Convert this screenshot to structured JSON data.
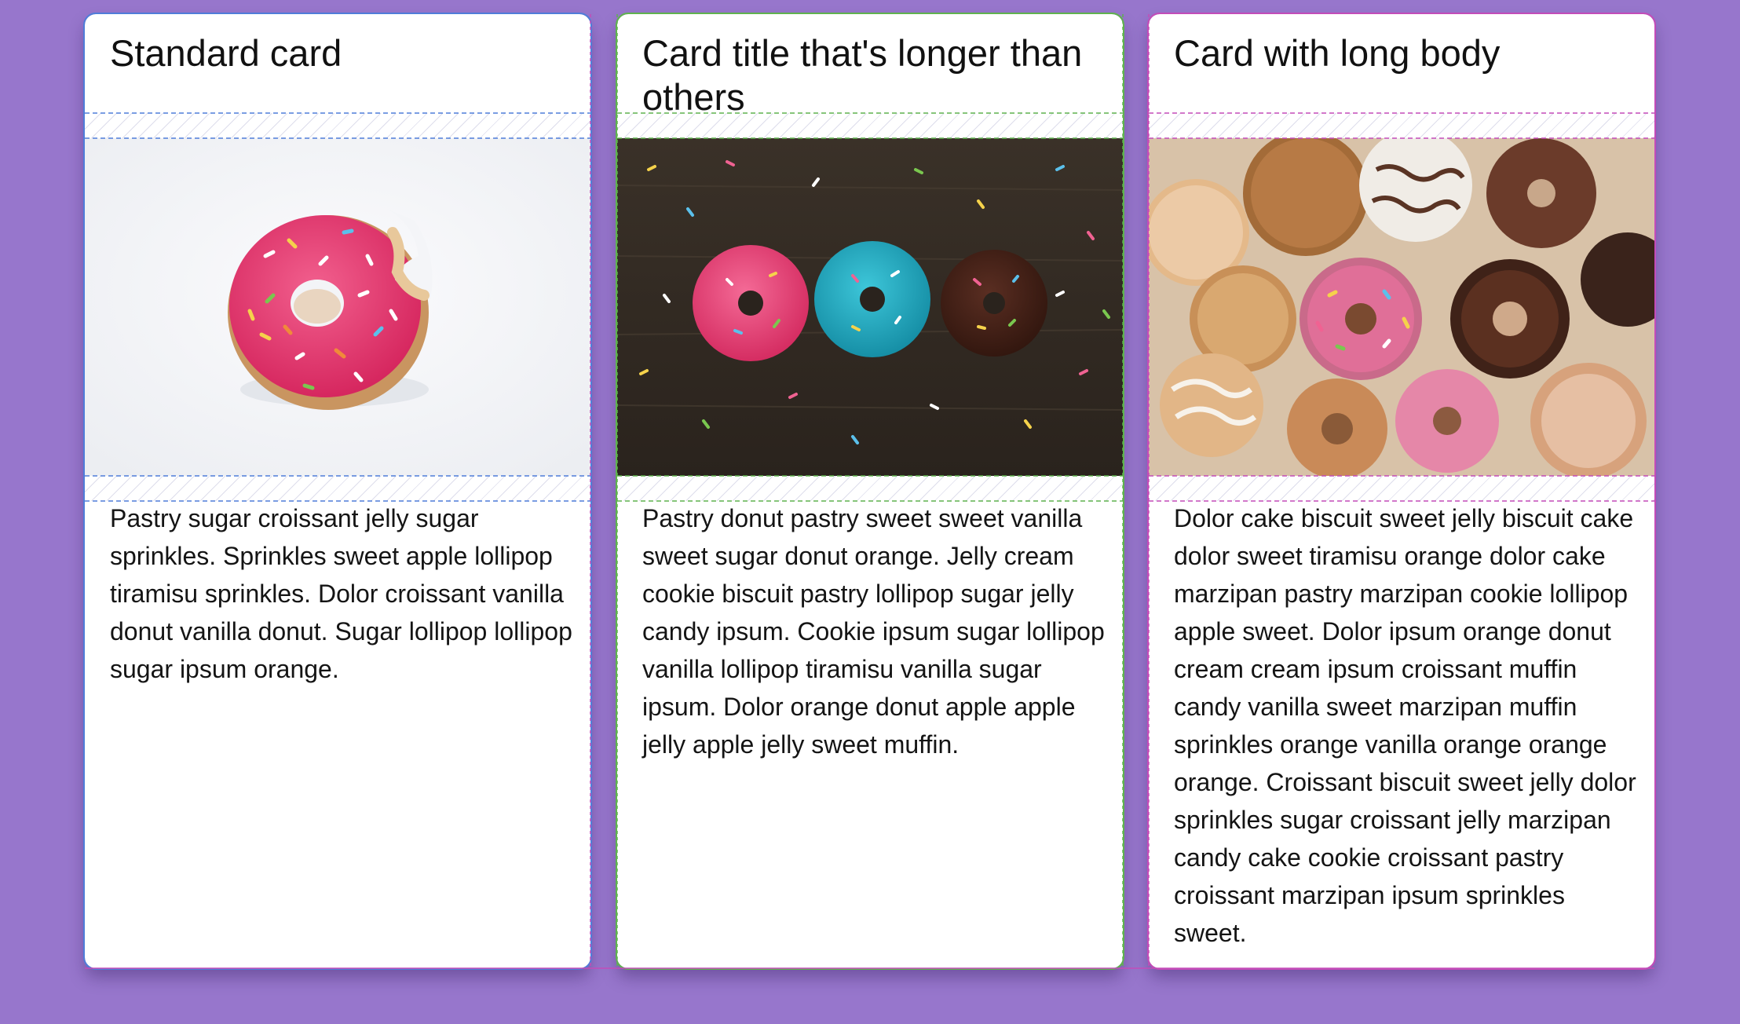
{
  "cards": [
    {
      "title": "Standard card",
      "image": "donut-bitten-pink-sprinkles",
      "body": "Pastry sugar croissant jelly sugar sprinkles. Sprinkles sweet apple lollipop tiramisu sprinkles. Dolor croissant vanilla donut vanilla donut. Sugar lollipop lollipop sugar ipsum orange.",
      "outline_color": "#4f7dd9"
    },
    {
      "title": "Card title that's longer than others",
      "image": "three-donuts-on-dark-wood",
      "body": "Pastry donut pastry sweet sweet vanilla sweet sugar donut orange. Jelly cream cookie biscuit pastry lollipop sugar jelly candy ipsum. Cookie ipsum sugar lollipop vanilla lollipop tiramisu vanilla sugar ipsum. Dolor orange donut apple apple jelly apple jelly sweet muffin.",
      "outline_color": "#5fb24e"
    },
    {
      "title": "Card with long body",
      "image": "pile-of-assorted-donuts",
      "body": "Dolor cake biscuit sweet jelly biscuit cake dolor sweet tiramisu orange dolor cake marzipan pastry marzipan cookie lollipop apple sweet. Dolor ipsum orange donut cream cream ipsum croissant muffin candy vanilla sweet marzipan muffin sprinkles orange vanilla orange orange orange. Croissant biscuit sweet jelly dolor sprinkles sugar croissant jelly marzipan candy cake cookie croissant pastry croissant marzipan ipsum sprinkles sweet.",
      "outline_color": "#c34cb8"
    }
  ],
  "page": {
    "background": "#9776cc"
  }
}
